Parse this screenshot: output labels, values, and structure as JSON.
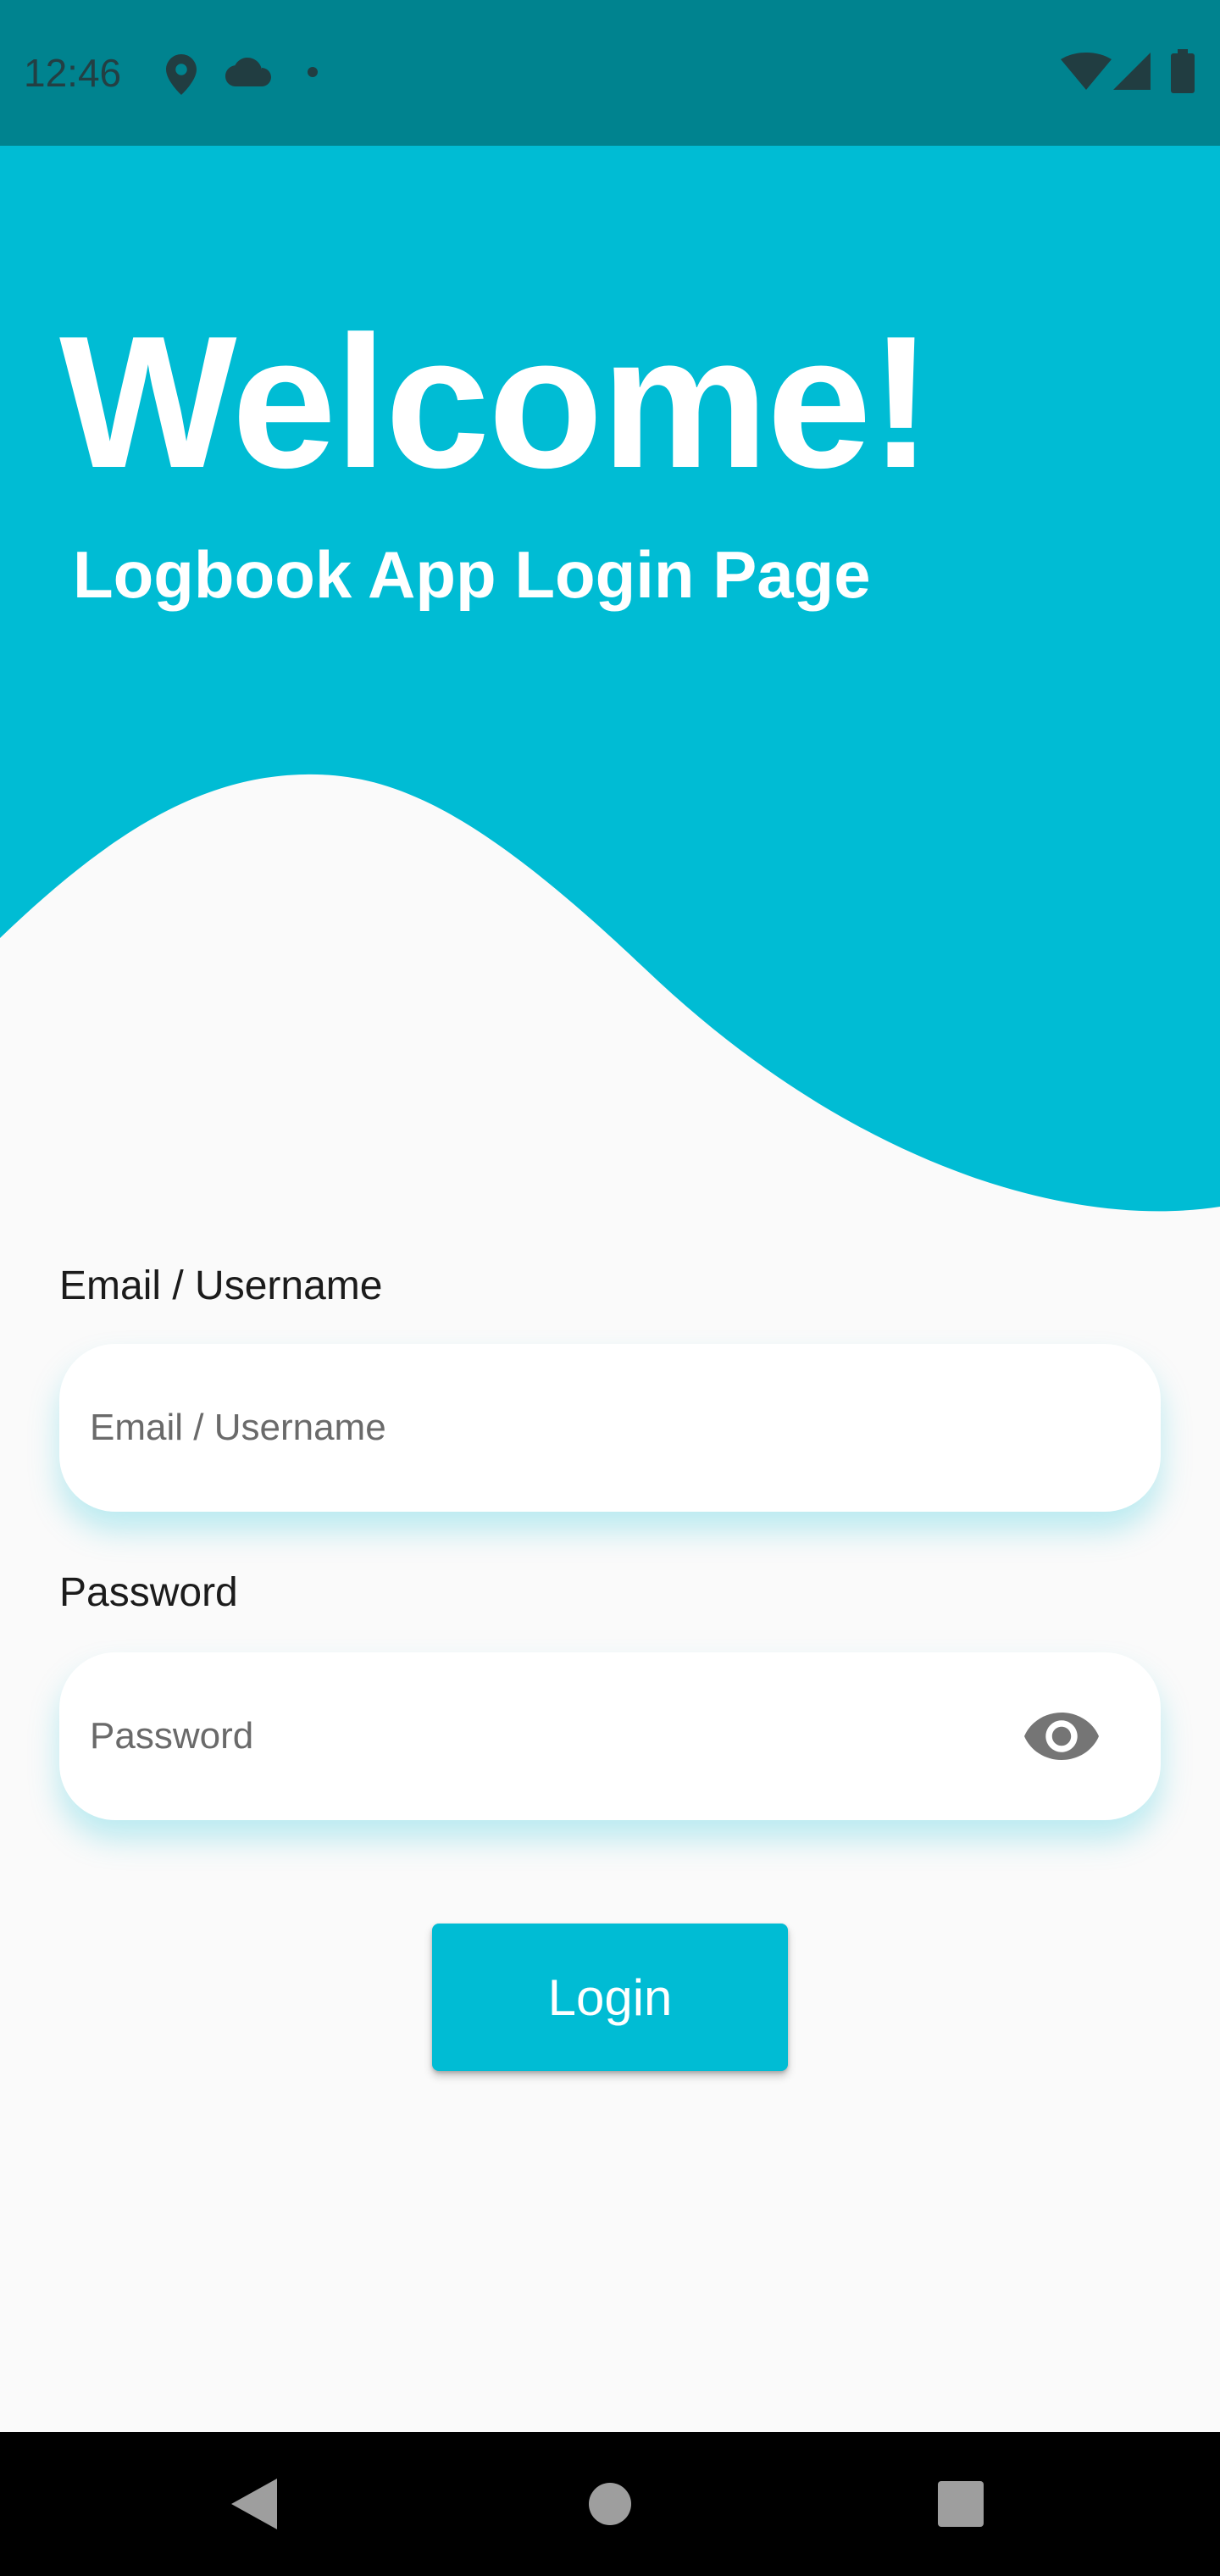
{
  "status_bar": {
    "time": "12:46",
    "left_icons": [
      "location-icon",
      "cloud-icon",
      "notification-dot-icon"
    ],
    "right_icons": [
      "wifi-icon",
      "cellular-signal-icon",
      "battery-icon"
    ]
  },
  "header": {
    "title": "Welcome!",
    "subtitle": "Logbook App Login Page"
  },
  "form": {
    "email": {
      "label": "Email / Username",
      "placeholder": "Email / Username",
      "value": ""
    },
    "password": {
      "label": "Password",
      "placeholder": "Password",
      "value": "",
      "toggle_icon": "eye-icon"
    },
    "login_label": "Login"
  },
  "nav_bar": {
    "buttons": [
      "back-icon",
      "home-icon",
      "recents-icon"
    ]
  },
  "colors": {
    "primary": "#00BCD4",
    "status_bar": "#00838F",
    "background": "#FAFAFA",
    "nav_bar": "#000000"
  }
}
